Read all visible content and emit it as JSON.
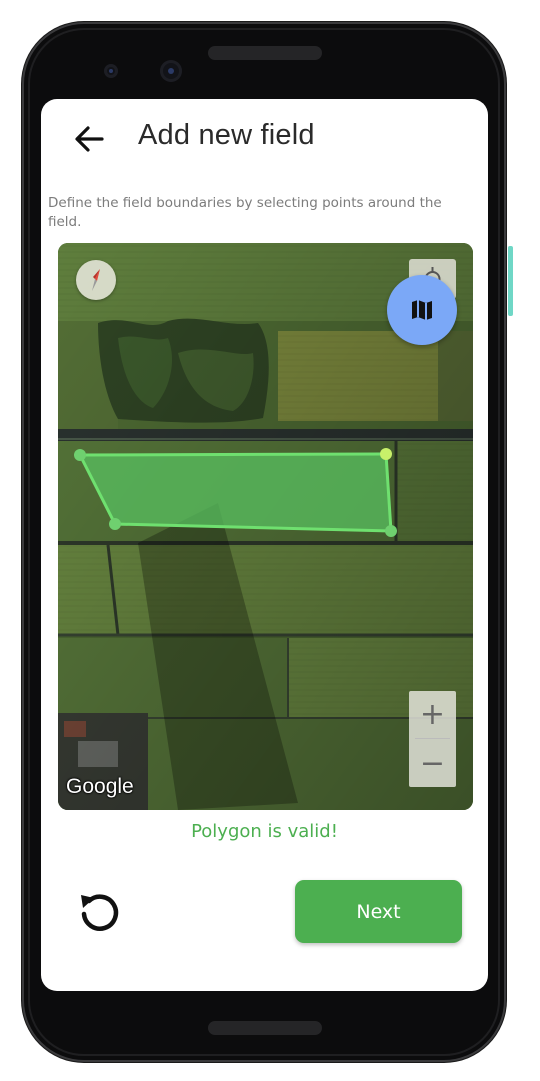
{
  "header": {
    "back_icon": "arrow-left-icon",
    "title": "Add new field"
  },
  "instructions": "Define the field boundaries by selecting points around the field.",
  "map": {
    "attribution": "Google",
    "compass_icon": "compass-icon",
    "locate_icon": "my-location-icon",
    "layer_icon": "map-icon",
    "zoom_in_label": "+",
    "zoom_out_label": "−",
    "polygon_color": "#4caf50",
    "polygon_vertex_count": 4
  },
  "status": {
    "text": "Polygon is valid!",
    "color": "#4caf50"
  },
  "actions": {
    "reset_icon": "reset-icon",
    "next_label": "Next"
  },
  "colors": {
    "accent": "#4caf50",
    "fab": "#7ba8f7"
  }
}
